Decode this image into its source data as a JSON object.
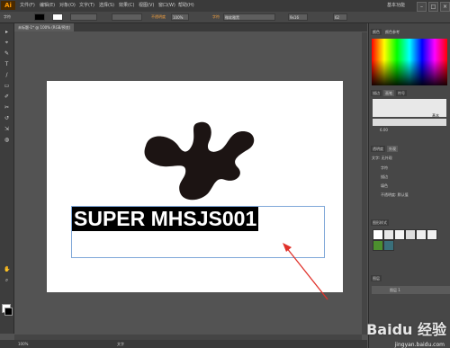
{
  "app": {
    "logo": "Ai"
  },
  "menubar": {
    "items": [
      "文件(F)",
      "编辑(E)",
      "对象(O)",
      "文字(T)",
      "选择(S)",
      "效果(C)",
      "视图(V)",
      "窗口(W)",
      "帮助(H)"
    ],
    "workspace": "基本功能",
    "window_controls": [
      "–",
      "□",
      "×"
    ]
  },
  "controlbar": {
    "label": "字符",
    "opacity_label": "不透明度",
    "opacity_value": "100%",
    "font_label": "字符",
    "font_value": "微软雅黑",
    "size_value": "9x16",
    "zoom_value": "62"
  },
  "document": {
    "tab_title": "未标题-1* @ 100% (RGB/预览)"
  },
  "canvas": {
    "text": "SUPER MHSJS001",
    "text_color": "#ffffff",
    "highlight_color": "#000000",
    "arrow_color": "#e0312a"
  },
  "tools": [
    "▸",
    "⌖",
    "✎",
    "T",
    "/",
    "▭",
    "✐",
    "✂",
    "↺",
    "⇲",
    "◍",
    "✋",
    "⌕"
  ],
  "panels": {
    "color_tabs": [
      "颜色",
      "颜色参考"
    ],
    "brush_tabs": [
      "描边",
      "画笔",
      "符号"
    ],
    "brush_label": "基本",
    "brush_size": "6.00",
    "appearance_tabs": [
      "透明度",
      "外观"
    ],
    "appearance_rows": [
      "文字",
      "字符",
      "描边",
      "填色",
      "不透明度: 默认值"
    ],
    "appearance_text_row": "文字: 无外观",
    "graphic_style_tab": "图形样式",
    "layers_tab": "图层",
    "layers_name": "图层 1"
  },
  "status": {
    "zoom": "100%",
    "tool": "文字"
  },
  "watermark": {
    "brand": "Baidu 经验",
    "url": "jingyan.baidu.com"
  }
}
